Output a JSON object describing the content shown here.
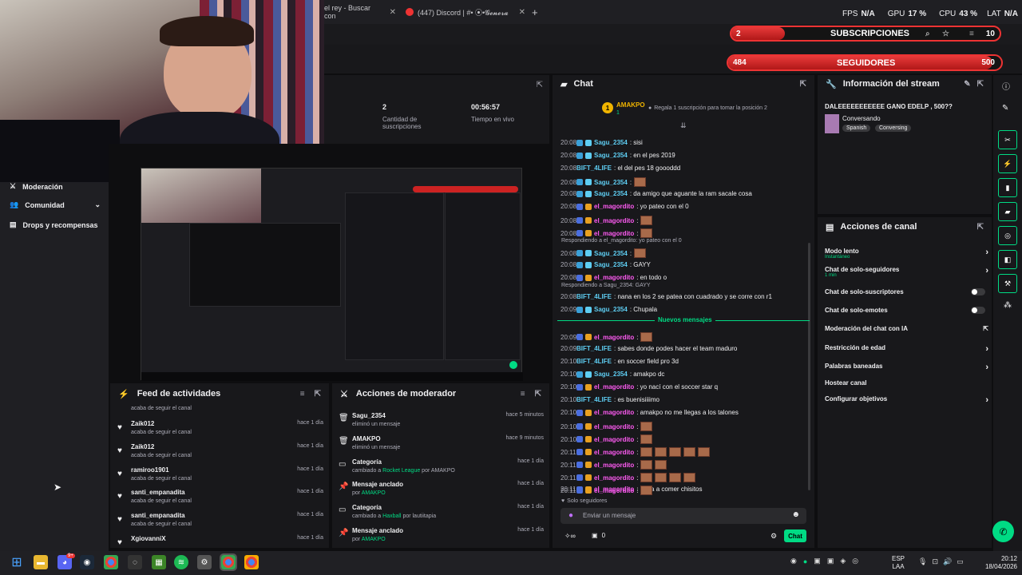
{
  "browser": {
    "tabs": [
      {
        "label": "el rey - Buscar con"
      },
      {
        "label": "(447) Discord | #• ⦿•𝓖𝓮𝓷𝓮𝓻𝓪"
      }
    ],
    "new_tab": "+"
  },
  "stats": {
    "fps_label": "FPS",
    "fps": "N/A",
    "gpu_label": "GPU",
    "gpu": "17 %",
    "cpu_label": "CPU",
    "cpu": "43 %",
    "lat_label": "LAT",
    "lat": "N/A"
  },
  "overlays": {
    "subs": {
      "current": "2",
      "label": "SUBSCRIPCIONES",
      "goal": "10",
      "progress": 0.2
    },
    "followers": {
      "current": "484",
      "label": "SEGUIDORES",
      "goal": "500",
      "progress": 0.968
    }
  },
  "sidebar": {
    "items": [
      {
        "label": "Moderación"
      },
      {
        "label": "Comunidad"
      },
      {
        "label": "Drops y recompensas"
      }
    ]
  },
  "stats_panel": {
    "subs_value": "2",
    "subs_label": "Cantidad de suscripciones",
    "live_value": "00:56:57",
    "live_label": "Tiempo en vivo"
  },
  "chat": {
    "title": "Chat",
    "top_user": "AMAKPO",
    "top_rank": "1",
    "top_count": "1",
    "top_prompt": "Regala 1 suscripción para tomar la posición 2",
    "lines": [
      {
        "time": "20:08",
        "user": "Sagu_2354",
        "msg": ": sisi",
        "color": "#5ecdf2"
      },
      {
        "time": "20:08",
        "user": "Sagu_2354",
        "msg": ": en el pes 2019",
        "color": "#5ecdf2"
      },
      {
        "time": "20:08",
        "user": "BIFT_4LIFE",
        "msg": ": el del pes 18 goooddd",
        "color": "#5ecdf2"
      },
      {
        "time": "20:08",
        "user": "Sagu_2354",
        "msg": ":",
        "color": "#5ecdf2"
      },
      {
        "time": "20:08",
        "user": "Sagu_2354",
        "msg": ": da amigo que aguante la ram sacale cosa",
        "color": "#5ecdf2"
      },
      {
        "time": "20:08",
        "user": "el_magordito",
        "msg": ": yo pateo con el 0",
        "color": "#ff5bf3"
      },
      {
        "time": "20:08",
        "user": "el_magordito",
        "msg": ":",
        "color": "#ff5bf3"
      },
      {
        "time": "20:08",
        "user": "el_magordito",
        "msg": ":",
        "color": "#ff5bf3"
      },
      {
        "time": "20:08",
        "user": "Sagu_2354",
        "msg": ":",
        "color": "#5ecdf2"
      },
      {
        "time": "20:08",
        "user": "Sagu_2354",
        "msg": ": GAYY",
        "color": "#5ecdf2"
      },
      {
        "time": "20:08",
        "user": "el_magordito",
        "msg": ": en todo o",
        "color": "#ff5bf3"
      },
      {
        "time": "20:08",
        "user": "BIFT_4LIFE",
        "msg": ": nana en los 2 se patea con cuadrado y se corre con r1",
        "color": "#5ecdf2"
      },
      {
        "time": "20:09",
        "user": "Sagu_2354",
        "msg": ": Chupala",
        "color": "#5ecdf2"
      },
      {
        "time": "20:09",
        "user": "el_magordito",
        "msg": ":",
        "color": "#ff5bf3"
      },
      {
        "time": "20:09",
        "user": "BIFT_4LIFE",
        "msg": ": sabes donde podes hacer el team maduro",
        "color": "#5ecdf2"
      },
      {
        "time": "20:10",
        "user": "BIFT_4LIFE",
        "msg": ": en soccer field pro 3d",
        "color": "#5ecdf2"
      },
      {
        "time": "20:10",
        "user": "Sagu_2354",
        "msg": ": amakpo dc",
        "color": "#5ecdf2"
      },
      {
        "time": "20:10",
        "user": "el_magordito",
        "msg": ": yo nací con el soccer star q",
        "color": "#ff5bf3"
      },
      {
        "time": "20:10",
        "user": "BIFT_4LIFE",
        "msg": ": es buenisiiiimo",
        "color": "#5ecdf2"
      },
      {
        "time": "20:10",
        "user": "el_magordito",
        "msg": ": amakpo no me llegas a los talones",
        "color": "#ff5bf3"
      },
      {
        "time": "20:10",
        "user": "el_magordito",
        "msg": ":",
        "color": "#ff5bf3"
      },
      {
        "time": "20:10",
        "user": "el_magordito",
        "msg": ":",
        "color": "#ff5bf3"
      },
      {
        "time": "20:11",
        "user": "el_magordito",
        "msg": ":",
        "color": "#ff5bf3"
      },
      {
        "time": "20:11",
        "user": "el_magordito",
        "msg": ":",
        "color": "#ff5bf3"
      },
      {
        "time": "20:11",
        "user": "el_magordito",
        "msg": ":",
        "color": "#ff5bf3"
      },
      {
        "time": "20:11",
        "user": "el_magordito",
        "msg": ": anda a comer chisitos",
        "color": "#ff5bf3"
      },
      {
        "time": "20:11",
        "user": "el_magordito",
        "msg": ":",
        "color": "#ff5bf3"
      }
    ],
    "replies": [
      "Respondiendo a el_magordito: yo pateo con el 0",
      "Respondiendo a Sagu_2354: GAYY"
    ],
    "new_messages": "Nuevos mensajes",
    "followers_only": "Solo seguidores",
    "input_placeholder": "Enviar un mensaje",
    "points": "0",
    "send": "Chat"
  },
  "stream_info": {
    "title_label": "Información del stream",
    "stream_title": "DALEEEEEEEEEEE GANO EDELP , 500??",
    "category": "Conversando",
    "tags": [
      "Spanish",
      "Conversing"
    ]
  },
  "channel_actions": {
    "title": "Acciones de canal",
    "items": [
      {
        "label": "Modo lento",
        "sub": "Instantáneo",
        "kind": "chev"
      },
      {
        "label": "Chat de solo-seguidores",
        "sub": "1 min",
        "kind": "chev"
      },
      {
        "label": "Chat de solo-suscriptores",
        "sub": "",
        "kind": "toggle"
      },
      {
        "label": "Chat de solo-emotes",
        "sub": "",
        "kind": "toggle"
      },
      {
        "label": "Moderación del chat con IA",
        "sub": "",
        "kind": "ext"
      },
      {
        "label": "Restricción de edad",
        "sub": "",
        "kind": "chev"
      },
      {
        "label": "Palabras baneadas",
        "sub": "",
        "kind": "chev"
      },
      {
        "label": "Hostear canal",
        "sub": "",
        "kind": "none"
      },
      {
        "label": "Configurar objetivos",
        "sub": "",
        "kind": "chev"
      }
    ]
  },
  "feed": {
    "title": "Feed de actividades",
    "top_partial": "acaba de seguir el canal",
    "items": [
      {
        "name": "Zaik012",
        "sub": "acaba de seguir el canal",
        "date": "hace 1 día"
      },
      {
        "name": "Zaik012",
        "sub": "acaba de seguir el canal",
        "date": "hace 1 día"
      },
      {
        "name": "ramiroo1901",
        "sub": "acaba de seguir el canal",
        "date": "hace 1 día"
      },
      {
        "name": "santi_empanadita",
        "sub": "acaba de seguir el canal",
        "date": "hace 1 día"
      },
      {
        "name": "santi_empanadita",
        "sub": "acaba de seguir el canal",
        "date": "hace 1 día"
      },
      {
        "name": "XgiovanniX",
        "sub": "",
        "date": "hace 1 día"
      }
    ]
  },
  "mod_actions": {
    "title": "Acciones de moderador",
    "items": [
      {
        "name": "Sagu_2354",
        "sub": "eliminó un mensaje",
        "extra": "",
        "by": "",
        "date": "hace 5 minutos",
        "icon": "trash"
      },
      {
        "name": "AMAKPO",
        "sub": "eliminó un mensaje",
        "extra": "",
        "by": "",
        "date": "hace 9 minutos",
        "icon": "trash"
      },
      {
        "name": "Categoría",
        "sub": "cambiado a ",
        "extra": "Rocket League",
        "by": " por AMAKPO",
        "date": "hace 1 día",
        "icon": "cat"
      },
      {
        "name": "Mensaje anclado",
        "sub": "por ",
        "extra": "AMAKPO",
        "by": "",
        "date": "hace 1 día",
        "icon": "pin"
      },
      {
        "name": "Categoría",
        "sub": "cambiado a ",
        "extra": "Haxball",
        "by": " por lautiitapia",
        "date": "hace 1 día",
        "icon": "cat"
      },
      {
        "name": "Mensaje anclado",
        "sub": "por ",
        "extra": "AMAKPO",
        "by": "",
        "date": "hace 1 día",
        "icon": "pin"
      }
    ]
  },
  "taskbar": {
    "lang1": "ESP",
    "lang2": "LAA",
    "time": "20:12",
    "date": "18/04/2026",
    "notif_badge": "9+"
  },
  "colors": {
    "accent": "#00db84",
    "overlay_red": "#e33b3b",
    "panel": "#18181b",
    "bg": "#0e0e10"
  }
}
